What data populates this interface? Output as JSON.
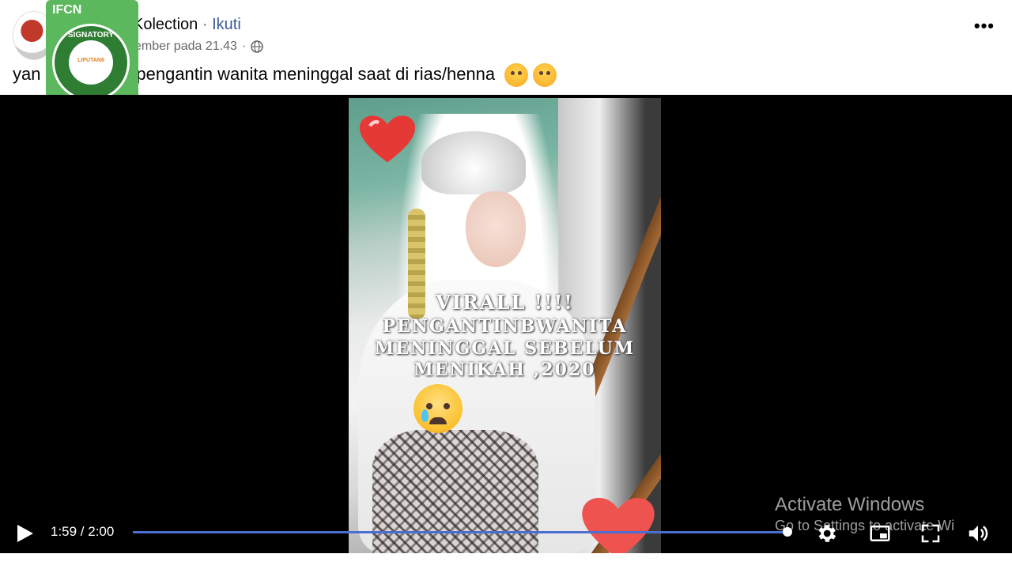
{
  "post": {
    "page_name": "Kolection",
    "separator": "·",
    "follow_label": "Ikuti",
    "timestamp": "ember pada 21.43",
    "meta_separator": "·",
    "more_label": "•••",
    "caption_start": "yan",
    "caption_rest": "ll pengantin wanita meninggal saat di rias/henna"
  },
  "badge": {
    "top_text": "IFCN",
    "ring_text": "SIGNATORY",
    "logo_text": "LIPUTAN6"
  },
  "video": {
    "overlay_lines": [
      "VIRALL !!!!",
      "PENGANTINBWANITA",
      "MENINGGAL SEBELUM",
      "MENIKAH ,2020"
    ],
    "current_time": "1:59",
    "duration": "2:00",
    "time_display": "1:59 / 2:00",
    "progress_fraction": 0.995
  },
  "watermark": {
    "line1": "Activate Windows",
    "line2": "Go to Settings to activate Wi"
  },
  "colors": {
    "follow_link": "#385898",
    "progress_bar": "#4a6fd1",
    "badge_green": "#5cb85c"
  },
  "icons": [
    "globe-icon",
    "more-icon",
    "crying-emoji-icon",
    "heart-icon",
    "play-icon",
    "settings-icon",
    "pip-icon",
    "fullscreen-icon",
    "volume-icon"
  ]
}
